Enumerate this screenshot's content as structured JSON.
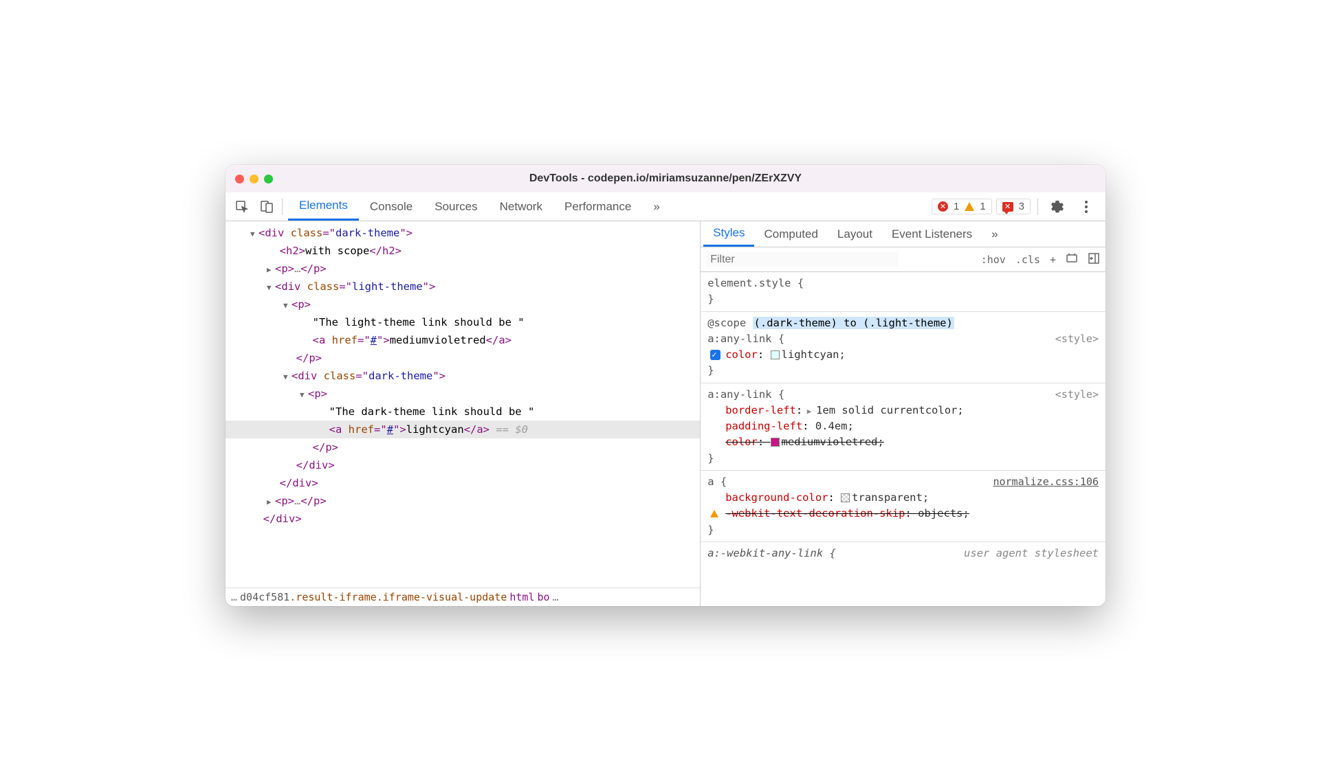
{
  "title": "DevTools - codepen.io/miriamsuzanne/pen/ZErXZVY",
  "toolbar_tabs": {
    "elements": "Elements",
    "console": "Console",
    "sources": "Sources",
    "network": "Network",
    "performance": "Performance",
    "more": "»"
  },
  "badges": {
    "errors": "1",
    "warnings": "1",
    "messages": "3"
  },
  "dom": {
    "div_dark_open": "div",
    "class_attr": "class",
    "dark_theme_val": "dark-theme",
    "h2": "h2",
    "h2_text": "with scope",
    "p": "p",
    "ellipsis": "…",
    "light_theme_val": "light-theme",
    "light_text": "\"The light-theme link should be \"",
    "a": "a",
    "href": "href",
    "hash": "#",
    "mvr_text": "mediumvioletred",
    "dark_text": "\"The dark-theme link should be \"",
    "lc_text": "lightcyan",
    "dollar": "== $0"
  },
  "breadcrumb": {
    "ell": "…",
    "iframe": "d04cf581",
    "result": ".result-iframe.iframe-visual-update",
    "html": "html",
    "body": "bo",
    "ell2": "…"
  },
  "styles": {
    "tabs": {
      "styles": "Styles",
      "computed": "Computed",
      "layout": "Layout",
      "event": "Event Listeners",
      "more": "»"
    },
    "filter_placeholder": "Filter",
    "hov": ":hov",
    "cls": ".cls",
    "plus": "+",
    "element_style": "element.style {",
    "brace_close": "}",
    "scope_prefix": "@scope",
    "scope_hl": "(.dark-theme) to (.light-theme)",
    "anylink_sel": "a:any-link {",
    "style_src": "<style>",
    "color_prop": "color",
    "lightcyan": "lightcyan;",
    "border_left": "border-left",
    "border_left_val": "1em solid currentcolor;",
    "padding_left": "padding-left",
    "padding_left_val": "0.4em;",
    "mvr_val": "mediumvioletred;",
    "a_sel": "a {",
    "normalize": "normalize.css:106",
    "bg_color": "background-color",
    "transparent": "transparent;",
    "webkit_skip": "-webkit-text-decoration-skip",
    "objects": "objects;",
    "webkit_anylink": "a:-webkit-any-link {",
    "user_agent": "user agent stylesheet"
  }
}
